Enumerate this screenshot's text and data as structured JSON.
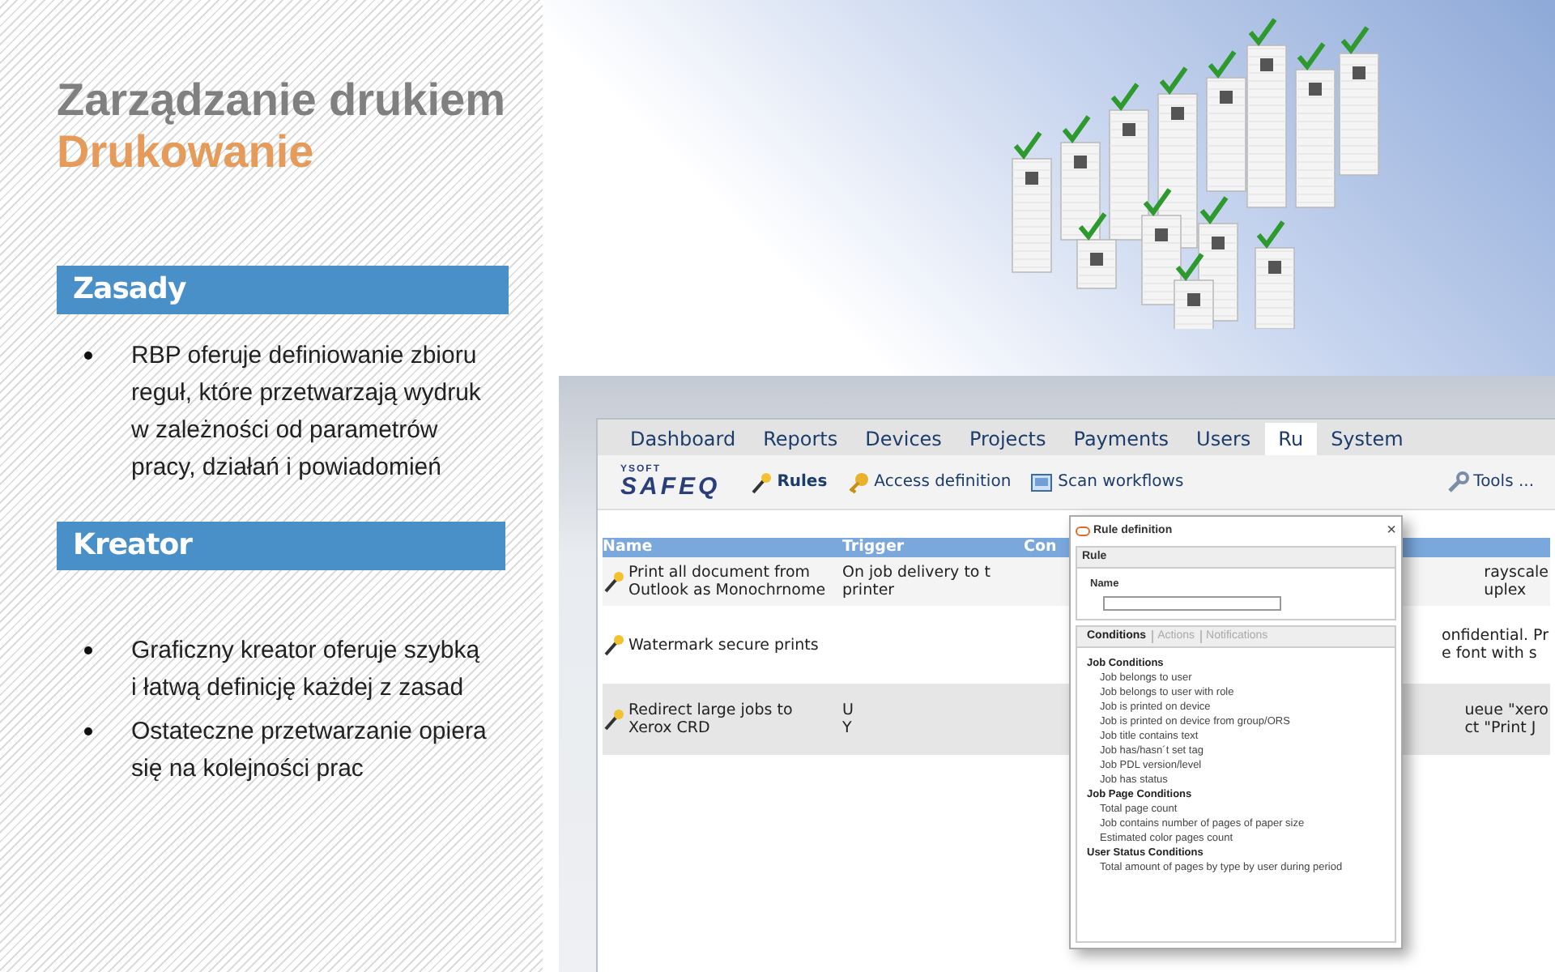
{
  "title": "Zarządzanie drukiem",
  "subtitle": "Drukowanie",
  "sections": [
    {
      "heading": "Zasady",
      "bullets": [
        "RBP oferuje definiowanie zbioru reguł, które przetwarzają wydruk w zależności od parametrów pracy, działań i powiadomień"
      ]
    },
    {
      "heading": "Kreator",
      "bullets": [
        "Graficzny kreator oferuje szybką i łatwą definicję każdej z zasad",
        "Ostateczne przetwarzanie opiera się na kolejności prac"
      ]
    }
  ],
  "app": {
    "tabs": [
      {
        "label": "Dashboard",
        "selected": false
      },
      {
        "label": "Reports",
        "selected": false
      },
      {
        "label": "Devices",
        "selected": false
      },
      {
        "label": "Projects",
        "selected": false
      },
      {
        "label": "Payments",
        "selected": false
      },
      {
        "label": "Users",
        "selected": false
      },
      {
        "label": "Ru",
        "selected": true
      },
      {
        "label": "System",
        "selected": false
      }
    ],
    "logo": {
      "small": "YSOFT",
      "big": "SAFEQ"
    },
    "toolbar": [
      {
        "label": "Rules",
        "selected": true,
        "kind": "rules"
      },
      {
        "label": "Access definition",
        "selected": false,
        "kind": "key"
      },
      {
        "label": "Scan workflows",
        "selected": false,
        "kind": "scan"
      },
      {
        "label": "Tools ...",
        "selected": false,
        "kind": "tools"
      }
    ],
    "table": {
      "columns": [
        "Name",
        "Trigger",
        "Con"
      ],
      "rows": [
        {
          "name": "Print all document from Outlook as Monochrnome",
          "trigger": "On job delivery to t\nprinter",
          "column_4": "rayscale\nuplex"
        },
        {
          "name": "Watermark secure prints",
          "trigger": "",
          "column_4": "onfidential. Pr\ne font with s"
        },
        {
          "name": "Redirect large jobs to Xerox CRD",
          "trigger": "U\nY",
          "column_4": "ueue \"xero\nct \"Print J"
        }
      ]
    }
  },
  "dialog": {
    "title": "Rule definition",
    "close": "×",
    "tabs": [
      {
        "label": "Conditions",
        "selected": true
      },
      {
        "label": "Actions",
        "selected": false
      },
      {
        "label": "Notifications",
        "selected": false
      }
    ],
    "conditions": [
      {
        "label": "Job Conditions",
        "children": [
          {
            "label": "Job belongs to user"
          },
          {
            "label": "Job belongs to user with role"
          },
          {
            "label": "Job is printed on device"
          },
          {
            "label": "Job is printed on device from group/ORS"
          },
          {
            "label": "Job title contains text"
          },
          {
            "label": "Job has/hasn´t set tag"
          },
          {
            "label": "Job PDL version/level"
          },
          {
            "label": "Job has status"
          }
        ]
      },
      {
        "label": "Job Page Conditions",
        "children": [
          {
            "label": "Total page count"
          },
          {
            "label": "Job contains number of pages of paper size"
          },
          {
            "label": "Estimated color pages count"
          }
        ]
      },
      {
        "label": "User Status Conditions",
        "children": [
          {
            "label": "Total amount of pages by type by user during period"
          }
        ]
      }
    ],
    "rule_panel": {
      "title": "Rule",
      "name_label": "Name"
    }
  }
}
